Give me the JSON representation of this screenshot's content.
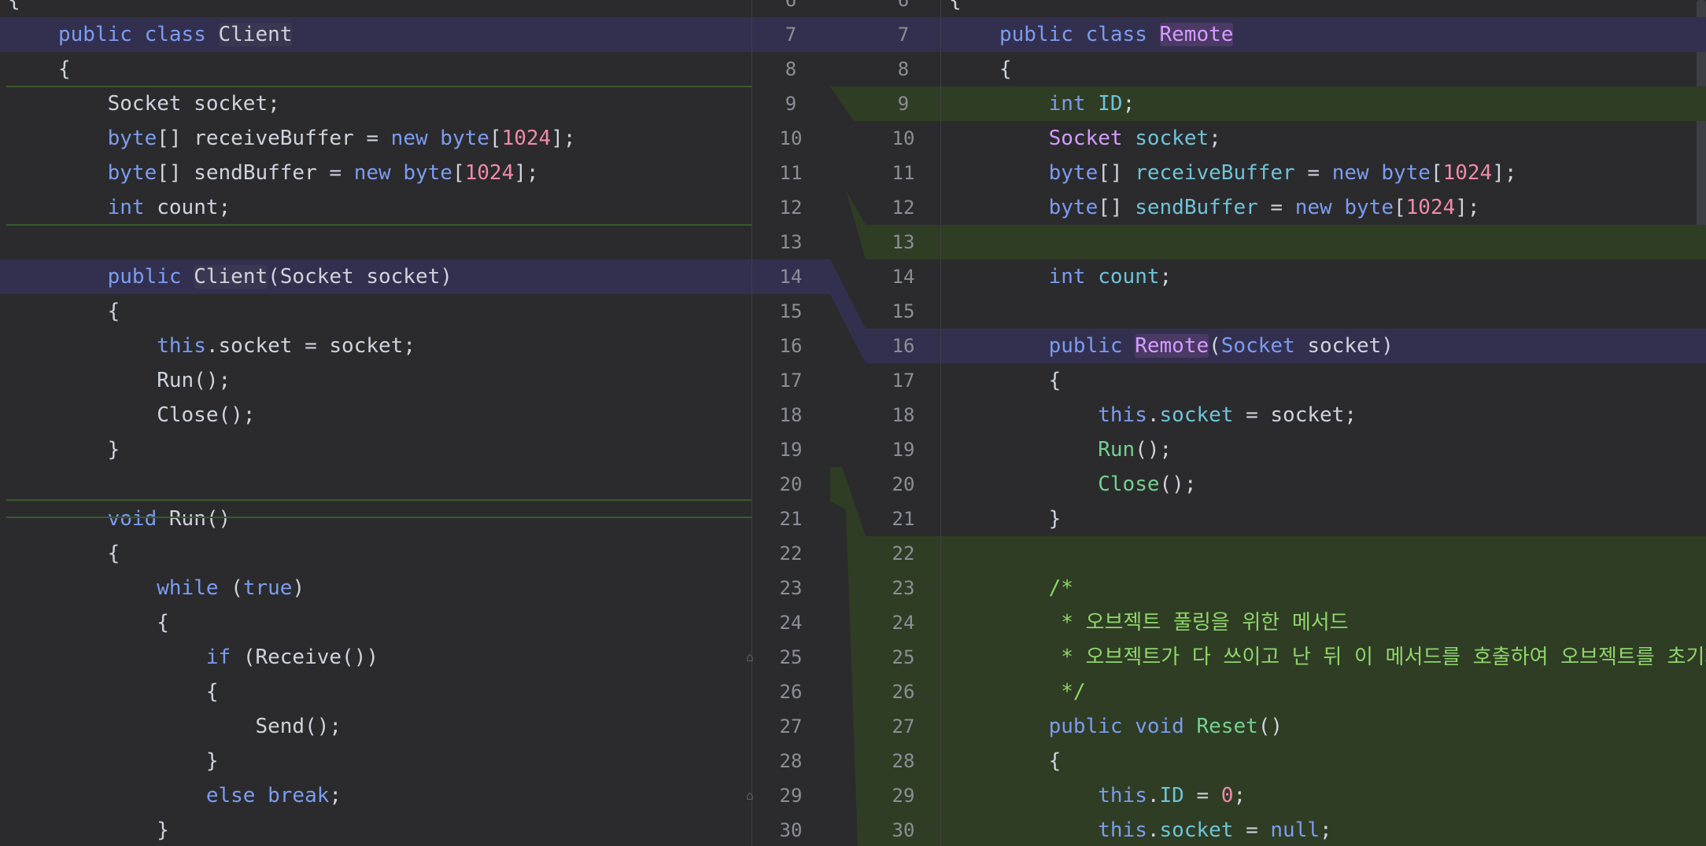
{
  "left": {
    "top_partial": "{",
    "lines": [
      {
        "tokens": [
          [
            "kw",
            "public "
          ],
          [
            "kw",
            "class "
          ],
          [
            "cls",
            "Client"
          ]
        ]
      },
      {
        "tokens": [
          [
            "p",
            "{"
          ]
        ]
      },
      {
        "tokens": [
          [
            "p",
            "    Socket socket;"
          ]
        ]
      },
      {
        "tokens": [
          [
            "p",
            "    "
          ],
          [
            "kw",
            "byte"
          ],
          [
            "p",
            "[] receiveBuffer = "
          ],
          [
            "kw",
            "new "
          ],
          [
            "kw",
            "byte"
          ],
          [
            "p",
            "["
          ],
          [
            "num",
            "1024"
          ],
          [
            "p",
            "];"
          ]
        ]
      },
      {
        "tokens": [
          [
            "p",
            "    "
          ],
          [
            "kw",
            "byte"
          ],
          [
            "p",
            "[] sendBuffer = "
          ],
          [
            "kw",
            "new "
          ],
          [
            "kw",
            "byte"
          ],
          [
            "p",
            "["
          ],
          [
            "num",
            "1024"
          ],
          [
            "p",
            "];"
          ]
        ]
      },
      {
        "tokens": [
          [
            "p",
            "    "
          ],
          [
            "kw",
            "int"
          ],
          [
            "p",
            " count;"
          ]
        ]
      },
      {
        "tokens": []
      },
      {
        "tokens": [
          [
            "p",
            "    "
          ],
          [
            "kw",
            "public "
          ],
          [
            "cls",
            "Client"
          ],
          [
            "p",
            "(Socket socket)"
          ]
        ]
      },
      {
        "tokens": [
          [
            "p",
            "    {"
          ]
        ]
      },
      {
        "tokens": [
          [
            "p",
            "        "
          ],
          [
            "kw",
            "this"
          ],
          [
            "p",
            ".socket = socket;"
          ]
        ]
      },
      {
        "tokens": [
          [
            "p",
            "        Run();"
          ]
        ]
      },
      {
        "tokens": [
          [
            "p",
            "        Close();"
          ]
        ]
      },
      {
        "tokens": [
          [
            "p",
            "    }"
          ]
        ]
      },
      {
        "tokens": []
      },
      {
        "tokens": [
          [
            "p",
            "    "
          ],
          [
            "kw",
            "void "
          ],
          [
            "p",
            "Run()"
          ]
        ]
      },
      {
        "tokens": [
          [
            "p",
            "    {"
          ]
        ]
      },
      {
        "tokens": [
          [
            "p",
            "        "
          ],
          [
            "kw",
            "while "
          ],
          [
            "p",
            "("
          ],
          [
            "kw",
            "true"
          ],
          [
            "p",
            ")"
          ]
        ]
      },
      {
        "tokens": [
          [
            "p",
            "        {"
          ]
        ]
      },
      {
        "tokens": [
          [
            "p",
            "            "
          ],
          [
            "kw",
            "if "
          ],
          [
            "p",
            "(Receive())"
          ]
        ]
      },
      {
        "tokens": [
          [
            "p",
            "            {"
          ]
        ]
      },
      {
        "tokens": [
          [
            "p",
            "                Send();"
          ]
        ]
      },
      {
        "tokens": [
          [
            "p",
            "            }"
          ]
        ]
      },
      {
        "tokens": [
          [
            "p",
            "            "
          ],
          [
            "kw",
            "else "
          ],
          [
            "kw",
            "break"
          ],
          [
            "p",
            ";"
          ]
        ]
      },
      {
        "tokens": [
          [
            "p",
            "        }"
          ]
        ]
      }
    ]
  },
  "right": {
    "top_partial": "{",
    "lines": [
      {
        "tokens": [
          [
            "kw",
            "public "
          ],
          [
            "kw",
            "class "
          ],
          [
            "rcls",
            "Remote"
          ]
        ]
      },
      {
        "tokens": [
          [
            "p",
            "{"
          ]
        ]
      },
      {
        "tokens": [
          [
            "p",
            "    "
          ],
          [
            "kw",
            "int "
          ],
          [
            "fld",
            "ID"
          ],
          [
            "p",
            ";"
          ]
        ]
      },
      {
        "tokens": [
          [
            "p",
            "    "
          ],
          [
            "rcls2",
            "Socket "
          ],
          [
            "fld",
            "socket"
          ],
          [
            "p",
            ";"
          ]
        ]
      },
      {
        "tokens": [
          [
            "p",
            "    "
          ],
          [
            "kw",
            "byte"
          ],
          [
            "p",
            "[] "
          ],
          [
            "fld",
            "receiveBuffer"
          ],
          [
            "p",
            " = "
          ],
          [
            "kw",
            "new "
          ],
          [
            "kw",
            "byte"
          ],
          [
            "p",
            "["
          ],
          [
            "num",
            "1024"
          ],
          [
            "p",
            "];"
          ]
        ]
      },
      {
        "tokens": [
          [
            "p",
            "    "
          ],
          [
            "kw",
            "byte"
          ],
          [
            "p",
            "[] "
          ],
          [
            "fld",
            "sendBuffer"
          ],
          [
            "p",
            " = "
          ],
          [
            "kw",
            "new "
          ],
          [
            "kw",
            "byte"
          ],
          [
            "p",
            "["
          ],
          [
            "num",
            "1024"
          ],
          [
            "p",
            "];"
          ]
        ]
      },
      {
        "tokens": []
      },
      {
        "tokens": [
          [
            "p",
            "    "
          ],
          [
            "kw",
            "int "
          ],
          [
            "fld",
            "count"
          ],
          [
            "p",
            ";"
          ]
        ]
      },
      {
        "tokens": []
      },
      {
        "tokens": [
          [
            "p",
            "    "
          ],
          [
            "kw",
            "public "
          ],
          [
            "rcls",
            "Remote"
          ],
          [
            "p",
            "("
          ],
          [
            "kw",
            "Socket "
          ],
          [
            "p",
            "socket)"
          ]
        ]
      },
      {
        "tokens": [
          [
            "p",
            "    {"
          ]
        ]
      },
      {
        "tokens": [
          [
            "p",
            "        "
          ],
          [
            "kw",
            "this"
          ],
          [
            "p",
            "."
          ],
          [
            "fld",
            "socket"
          ],
          [
            "p",
            " = socket;"
          ]
        ]
      },
      {
        "tokens": [
          [
            "p",
            "        "
          ],
          [
            "mth",
            "Run"
          ],
          [
            "p",
            "();"
          ]
        ]
      },
      {
        "tokens": [
          [
            "p",
            "        "
          ],
          [
            "mth",
            "Close"
          ],
          [
            "p",
            "();"
          ]
        ]
      },
      {
        "tokens": [
          [
            "p",
            "    }"
          ]
        ]
      },
      {
        "tokens": []
      },
      {
        "tokens": [
          [
            "p",
            "    "
          ],
          [
            "cmt",
            "/*"
          ]
        ]
      },
      {
        "tokens": [
          [
            "p",
            "    "
          ],
          [
            "cmt",
            " * 오브젝트 풀링을 위한 메서드"
          ]
        ]
      },
      {
        "tokens": [
          [
            "p",
            "    "
          ],
          [
            "cmt",
            " * 오브젝트가 다 쓰이고 난 뒤 이 메서드를 호출하여 오브젝트를 초기화"
          ]
        ]
      },
      {
        "tokens": [
          [
            "p",
            "    "
          ],
          [
            "cmt",
            " */"
          ]
        ]
      },
      {
        "tokens": [
          [
            "p",
            "    "
          ],
          [
            "kw",
            "public "
          ],
          [
            "kw",
            "void "
          ],
          [
            "mth",
            "Reset"
          ],
          [
            "p",
            "()"
          ]
        ]
      },
      {
        "tokens": [
          [
            "p",
            "    {"
          ]
        ]
      },
      {
        "tokens": [
          [
            "p",
            "        "
          ],
          [
            "kw",
            "this"
          ],
          [
            "p",
            "."
          ],
          [
            "fld",
            "ID"
          ],
          [
            "p",
            " = "
          ],
          [
            "num",
            "0"
          ],
          [
            "p",
            ";"
          ]
        ]
      },
      {
        "tokens": [
          [
            "p",
            "        "
          ],
          [
            "kw",
            "this"
          ],
          [
            "p",
            "."
          ],
          [
            "fld",
            "socket"
          ],
          [
            "p",
            " = "
          ],
          [
            "kw",
            "null"
          ],
          [
            "p",
            ";"
          ]
        ]
      }
    ]
  },
  "gutter": {
    "left_numbers": [
      "6",
      "7",
      "8",
      "9",
      "10",
      "11",
      "12",
      "13",
      "14",
      "15",
      "16",
      "17",
      "18",
      "19",
      "20",
      "21",
      "22",
      "23",
      "24",
      "25",
      "26",
      "27",
      "28",
      "29",
      "30"
    ],
    "right_numbers": [
      "6",
      "7",
      "8",
      "9",
      "10",
      "11",
      "12",
      "13",
      "14",
      "15",
      "16",
      "17",
      "18",
      "19",
      "20",
      "21",
      "22",
      "23",
      "24",
      "25",
      "26",
      "27",
      "28",
      "29",
      "30"
    ]
  },
  "colors": {
    "background": "#2b2b2d",
    "modified": "#33304f",
    "inserted": "#2f3d24",
    "keyword": "#7b9cf0",
    "number": "#f08aa8",
    "comment": "#8fd66b"
  }
}
